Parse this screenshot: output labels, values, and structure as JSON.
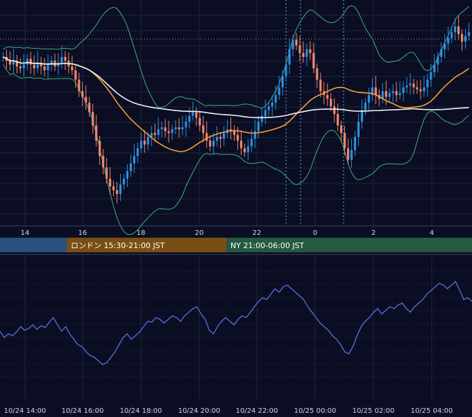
{
  "chart_data": [
    {
      "type": "candlestick",
      "x_tick_labels": [
        "14",
        "16",
        "18",
        "20",
        "22",
        "0",
        "2",
        "4"
      ],
      "overlays": [
        "bollinger-bands",
        "moving-average-orange",
        "moving-average-white"
      ],
      "colors": {
        "up": "#2e8fe0",
        "down": "#f0876e",
        "ma_fast": "#f5a034",
        "ma_slow": "#f2f2f2",
        "bands": "#3fb07a",
        "background": "#0b0e23",
        "grid": "#1e2440"
      },
      "close_series": [
        0.84,
        0.82,
        0.8,
        0.82,
        0.79,
        0.78,
        0.8,
        0.83,
        0.8,
        0.78,
        0.81,
        0.79,
        0.77,
        0.8,
        0.82,
        0.79,
        0.81,
        0.84,
        0.82,
        0.79,
        0.77,
        0.72,
        0.66,
        0.63,
        0.6,
        0.55,
        0.48,
        0.4,
        0.32,
        0.26,
        0.2,
        0.16,
        0.14,
        0.12,
        0.17,
        0.2,
        0.24,
        0.28,
        0.32,
        0.36,
        0.4,
        0.38,
        0.42,
        0.44,
        0.43,
        0.46,
        0.47,
        0.45,
        0.44,
        0.46,
        0.47,
        0.46,
        0.47,
        0.5,
        0.53,
        0.55,
        0.52,
        0.48,
        0.44,
        0.4,
        0.37,
        0.4,
        0.42,
        0.41,
        0.44,
        0.46,
        0.45,
        0.43,
        0.4,
        0.36,
        0.34,
        0.37,
        0.41,
        0.45,
        0.5,
        0.53,
        0.56,
        0.58,
        0.6,
        0.64,
        0.68,
        0.74,
        0.8,
        0.88,
        0.93,
        0.9,
        0.86,
        0.84,
        0.88,
        0.86,
        0.78,
        0.72,
        0.66,
        0.64,
        0.62,
        0.58,
        0.54,
        0.48,
        0.44,
        0.36,
        0.3,
        0.35,
        0.42,
        0.5,
        0.56,
        0.6,
        0.64,
        0.68,
        0.64,
        0.62,
        0.66,
        0.63,
        0.65,
        0.66,
        0.64,
        0.65,
        0.68,
        0.69,
        0.7,
        0.68,
        0.67,
        0.66,
        0.68,
        0.72,
        0.76,
        0.8,
        0.84,
        0.88,
        0.91,
        0.94,
        0.97,
        1.0,
        0.96,
        0.92,
        0.95,
        0.97
      ]
    },
    {
      "type": "line",
      "x_tick_labels": [
        "10/24 14:00",
        "10/24 16:00",
        "10/24 18:00",
        "10/24 20:00",
        "10/24 22:00",
        "10/25 00:00",
        "10/25 02:00",
        "10/25 04:00"
      ],
      "series_color": "#5b6fe0",
      "values": [
        0.45,
        0.38,
        0.42,
        0.4,
        0.44,
        0.5,
        0.46,
        0.48,
        0.52,
        0.47,
        0.51,
        0.49,
        0.55,
        0.6,
        0.52,
        0.45,
        0.5,
        0.42,
        0.36,
        0.3,
        0.28,
        0.22,
        0.18,
        0.16,
        0.12,
        0.08,
        0.1,
        0.16,
        0.22,
        0.3,
        0.38,
        0.42,
        0.36,
        0.4,
        0.44,
        0.5,
        0.56,
        0.55,
        0.6,
        0.58,
        0.54,
        0.58,
        0.62,
        0.6,
        0.56,
        0.62,
        0.66,
        0.7,
        0.72,
        0.64,
        0.58,
        0.46,
        0.42,
        0.5,
        0.56,
        0.6,
        0.56,
        0.52,
        0.58,
        0.62,
        0.6,
        0.66,
        0.72,
        0.78,
        0.82,
        0.8,
        0.86,
        0.92,
        0.88,
        0.94,
        0.96,
        0.92,
        0.88,
        0.84,
        0.8,
        0.72,
        0.66,
        0.6,
        0.54,
        0.5,
        0.46,
        0.4,
        0.36,
        0.3,
        0.22,
        0.2,
        0.28,
        0.4,
        0.5,
        0.56,
        0.6,
        0.66,
        0.7,
        0.64,
        0.68,
        0.72,
        0.7,
        0.74,
        0.76,
        0.7,
        0.66,
        0.72,
        0.76,
        0.8,
        0.86,
        0.9,
        0.94,
        0.98,
        0.96,
        0.92,
        0.96,
        1.0,
        0.9,
        0.8,
        0.82,
        0.78
      ]
    }
  ],
  "sessions": [
    {
      "label": ""
    },
    {
      "label": "ロンドン 15:30-21:00 JST"
    },
    {
      "label": "NY 21:00-06:00 JST"
    }
  ]
}
